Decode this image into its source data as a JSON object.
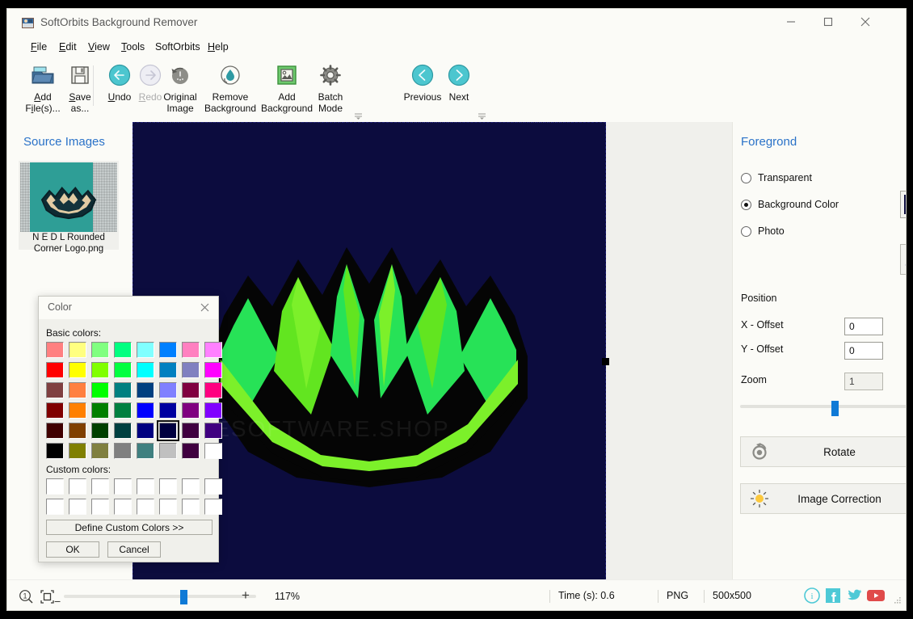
{
  "window": {
    "title": "SoftOrbits Background Remover",
    "icon": "app-icon",
    "minimize": "minimize-icon",
    "maximize": "maximize-icon",
    "close": "close-icon"
  },
  "menu": [
    {
      "label": "File",
      "accel": "F"
    },
    {
      "label": "Edit",
      "accel": "E"
    },
    {
      "label": "View",
      "accel": "V"
    },
    {
      "label": "Tools",
      "accel": "T"
    },
    {
      "label": "SoftOrbits",
      "accel": ""
    },
    {
      "label": "Help",
      "accel": "H"
    }
  ],
  "toolbar": {
    "buttons": [
      {
        "name": "add-files",
        "line1": "Add",
        "line2": "File(s)...",
        "icon": "open-folder-icon",
        "enabled": true
      },
      {
        "name": "save-as",
        "line1": "Save",
        "line2": "as...",
        "icon": "floppy-disk-icon",
        "enabled": true
      },
      {
        "name": "undo",
        "line1": "Undo",
        "line2": "",
        "icon": "undo-arrow-icon",
        "enabled": true
      },
      {
        "name": "redo",
        "line1": "Redo",
        "line2": "",
        "icon": "redo-arrow-icon",
        "enabled": false
      },
      {
        "name": "original-image",
        "line1": "Original",
        "line2": "Image",
        "icon": "clock-revert-icon",
        "enabled": true
      },
      {
        "name": "remove-background",
        "line1": "Remove",
        "line2": "Background",
        "icon": "droplet-icon",
        "enabled": true
      },
      {
        "name": "add-background",
        "line1": "Add",
        "line2": "Background",
        "icon": "picture-icon",
        "enabled": true
      },
      {
        "name": "batch-mode",
        "line1": "Batch",
        "line2": "Mode",
        "icon": "gear-icon",
        "enabled": true
      },
      {
        "name": "previous",
        "line1": "Previous",
        "line2": "",
        "icon": "chevron-left-circle-icon",
        "enabled": true
      },
      {
        "name": "next",
        "line1": "Next",
        "line2": "",
        "icon": "chevron-right-circle-icon",
        "enabled": true
      }
    ],
    "overflow_marker": "☰"
  },
  "sidebar": {
    "title": "Source Images",
    "items": [
      {
        "filename": "N E D L Rounded Corner Logo.png",
        "thumb_bg": "#2e9e96"
      }
    ]
  },
  "canvas": {
    "watermark": "© THESOFTWARE.SHOP",
    "background_color": "#0c0c3e",
    "logo_black": "#050505",
    "logo_green_bright": "#62e520",
    "logo_green_mid": "#27e257",
    "logo_green_light": "#7cf02a",
    "selection_handle": "resize-handle"
  },
  "right_panel": {
    "title": "Foregrond",
    "options": [
      {
        "label": "Transparent",
        "selected": false
      },
      {
        "label": "Background Color",
        "selected": true
      },
      {
        "label": "Photo",
        "selected": false
      }
    ],
    "background_color_value": "#0c0c3c",
    "photo_picker_icon": "folder-icon",
    "position_label": "Position",
    "x_offset_label": "X - Offset",
    "x_offset_value": "0",
    "y_offset_label": "Y - Offset",
    "y_offset_value": "0",
    "zoom_label": "Zoom",
    "zoom_value": "1",
    "rotate_label": "Rotate",
    "rotate_icon": "rotate-icon",
    "image_correction_label": "Image Correction",
    "image_correction_icon": "sun-icon"
  },
  "status_bar": {
    "zoom_icon": "zoom-one-to-one-icon",
    "fit_icon": "fit-to-screen-icon",
    "minus": "−",
    "plus": "+",
    "zoom_percent": "117%",
    "time": "Time (s): 0.6",
    "format": "PNG",
    "dimensions": "500x500",
    "social": [
      {
        "name": "info-icon",
        "glyph": "i",
        "color": "#4ec9d6"
      },
      {
        "name": "facebook-icon",
        "glyph": "f",
        "color": "#4ec9d6"
      },
      {
        "name": "twitter-icon",
        "glyph": "",
        "color": "#4ec9d6"
      },
      {
        "name": "youtube-icon",
        "glyph": "▶",
        "color": "#e04a4a"
      }
    ]
  },
  "color_dialog": {
    "title": "Color",
    "close_icon": "close-icon",
    "basic_colors_label": "Basic colors:",
    "custom_colors_label": "Custom colors:",
    "define_button": "Define Custom Colors >>",
    "ok_button": "OK",
    "cancel_button": "Cancel",
    "selected_index": 37,
    "basic_colors": [
      "#ff8080",
      "#ffff80",
      "#80ff80",
      "#00ff80",
      "#80ffff",
      "#0080ff",
      "#ff80c0",
      "#ff80ff",
      "#ff0000",
      "#ffff00",
      "#80ff00",
      "#00ff40",
      "#00ffff",
      "#0080c0",
      "#8080c0",
      "#ff00ff",
      "#804040",
      "#ff8040",
      "#00ff00",
      "#008080",
      "#004080",
      "#8080ff",
      "#800040",
      "#ff0080",
      "#800000",
      "#ff8000",
      "#008000",
      "#008040",
      "#0000ff",
      "#0000a0",
      "#800080",
      "#8000ff",
      "#400000",
      "#804000",
      "#004000",
      "#004040",
      "#000080",
      "#000040",
      "#400040",
      "#400080",
      "#000000",
      "#808000",
      "#808040",
      "#808080",
      "#408080",
      "#c0c0c0",
      "#400040",
      "#ffffff"
    ],
    "custom_colors_count": 16
  }
}
